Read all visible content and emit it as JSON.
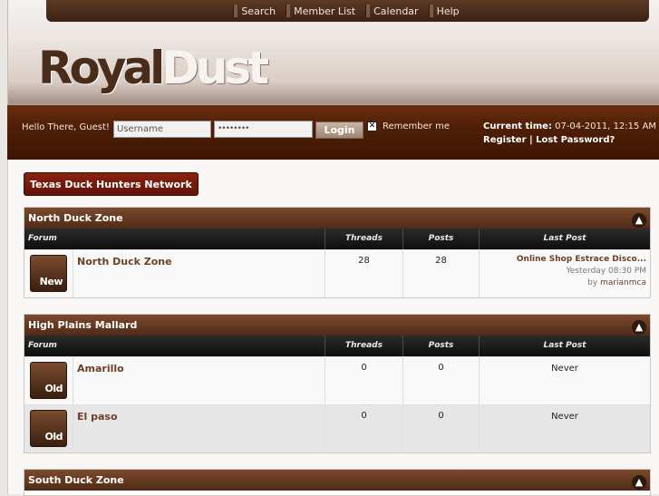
{
  "nav": [
    {
      "label": "Search",
      "icon": "search-icon"
    },
    {
      "label": "Member List",
      "icon": "members-icon"
    },
    {
      "label": "Calendar",
      "icon": "calendar-icon"
    },
    {
      "label": "Help",
      "icon": "help-icon"
    }
  ],
  "logo": {
    "part1": "Royal",
    "part2": "Dust"
  },
  "login": {
    "greeting": "Hello There, Guest!",
    "username_value": "Username",
    "password_value": "••••••••",
    "login_label": "Login",
    "remember_mark": "✕",
    "remember_label": "Remember me",
    "current_time_label": "Current time:",
    "current_time_value": "07-04-2011, 12:15 AM",
    "register_label": "Register",
    "separator": " | ",
    "lost_password_label": "Lost Password?"
  },
  "network_button": "Texas Duck Hunters Network",
  "columns": {
    "forum": "Forum",
    "threads": "Threads",
    "posts": "Posts",
    "last_post": "Last Post"
  },
  "categories": [
    {
      "title": "North Duck Zone",
      "forums": [
        {
          "badge": "New",
          "name": "North Duck Zone",
          "threads": "28",
          "posts": "28",
          "last_title": "Online Shop Estrace Disco...",
          "last_time": "Yesterday 08:30 PM",
          "last_by_prefix": "by ",
          "last_by": "marianmca"
        }
      ]
    },
    {
      "title": "High Plains Mallard",
      "forums": [
        {
          "badge": "Old",
          "name": "Amarillo",
          "threads": "0",
          "posts": "0",
          "last_post": "Never"
        },
        {
          "badge": "Old",
          "name": "El paso",
          "threads": "0",
          "posts": "0",
          "last_post": "Never"
        }
      ]
    },
    {
      "title": "South Duck Zone",
      "forums": []
    }
  ],
  "colors": {
    "brand_dark": "#4a2c1a",
    "login_bar": "#4f1f06",
    "network_button": "#8b2211"
  }
}
